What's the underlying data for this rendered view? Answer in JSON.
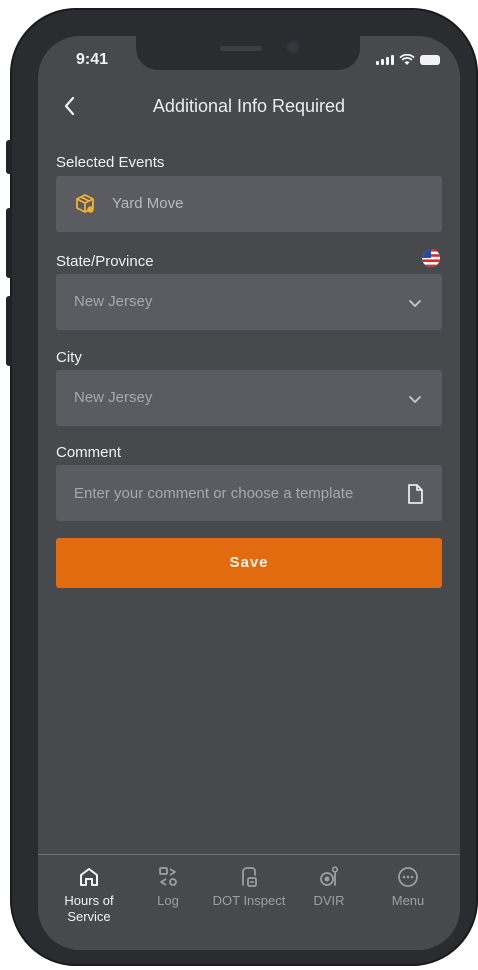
{
  "status_bar": {
    "time": "9:41"
  },
  "header": {
    "title": "Additional Info Required"
  },
  "form": {
    "selected_events": {
      "label": "Selected Events",
      "value": "Yard Move",
      "icon": "box-icon"
    },
    "state": {
      "label": "State/Province",
      "value": "New Jersey",
      "flag_icon": "us-flag-icon"
    },
    "city": {
      "label": "City",
      "value": "New Jersey"
    },
    "comment": {
      "label": "Comment",
      "placeholder": "Enter your comment or choose a template",
      "icon": "template-icon"
    },
    "save_label": "Save"
  },
  "tabbar": {
    "items": [
      {
        "label": "Hours of Service",
        "icon": "home-icon",
        "active": true
      },
      {
        "label": "Log",
        "icon": "log-icon",
        "active": false
      },
      {
        "label": "DOT Inspect",
        "icon": "dot-inspect-icon",
        "active": false
      },
      {
        "label": "DVIR",
        "icon": "dvir-icon",
        "active": false
      },
      {
        "label": "Menu",
        "icon": "menu-icon",
        "active": false
      }
    ]
  },
  "colors": {
    "accent": "#e36b0f",
    "screen_bg": "#48494d",
    "field_bg": "#5b5c61",
    "event_icon": "#f2b233"
  }
}
